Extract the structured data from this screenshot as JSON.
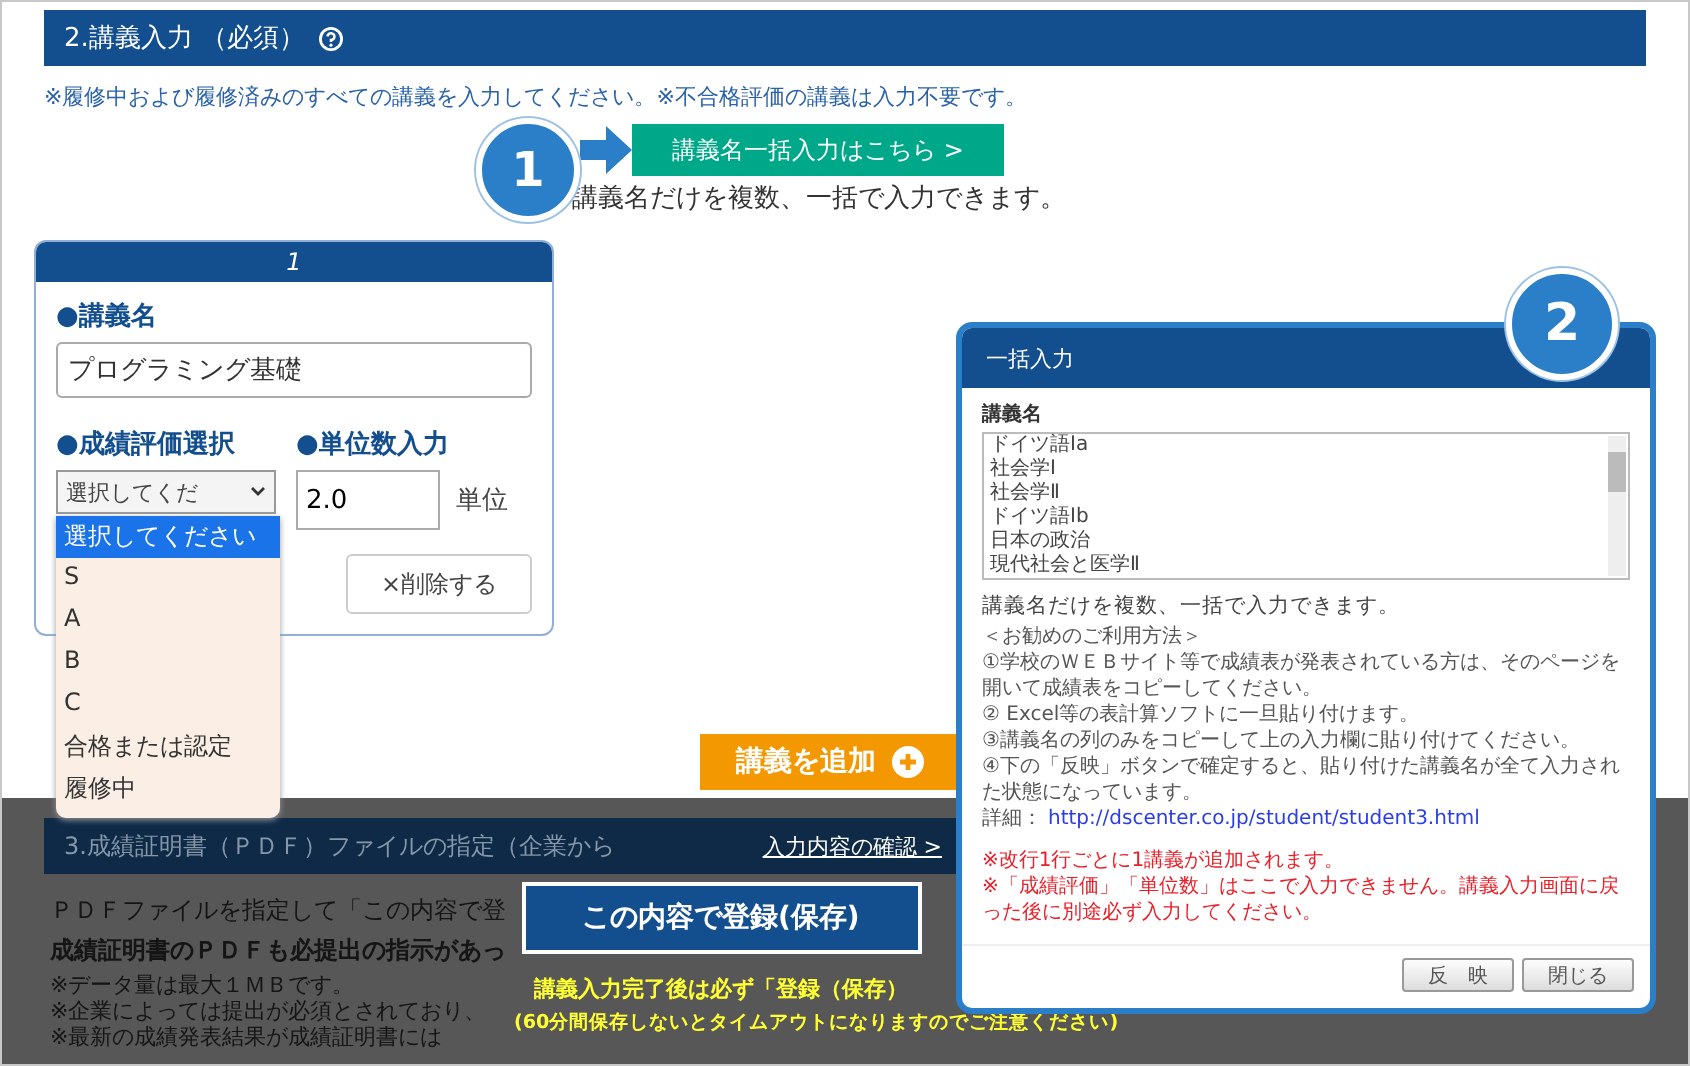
{
  "section2": {
    "title": "2.講義入力 （必須）",
    "note": "※履修中および履修済みのすべての講義を入力してください。※不合格評価の講義は入力不要です。",
    "step_badge": "1",
    "bulk_button": "講義名一括入力はこちら >",
    "bulk_caption": "講義名だけを複数、一括で入力できます。"
  },
  "course_card": {
    "number": "1",
    "name_label": "●講義名",
    "name_value": "プログラミング基礎",
    "grade_label": "●成績評価選択",
    "grade_value": "選択してくだ",
    "credit_label": "●単位数入力",
    "credit_value": "2.0",
    "credit_unit": "単位",
    "delete_button": "×削除する",
    "grade_options": [
      {
        "label": "選択してください",
        "selected": true
      },
      {
        "label": "S",
        "selected": false
      },
      {
        "label": "A",
        "selected": false
      },
      {
        "label": "B",
        "selected": false
      },
      {
        "label": "C",
        "selected": false
      },
      {
        "label": "合格または認定",
        "selected": false
      },
      {
        "label": "履修中",
        "selected": false
      }
    ]
  },
  "add_button": "講義を追加",
  "section3": {
    "title": "3.成績証明書（ＰＤＦ）ファイルの指定（企業から",
    "confirm_link": "入力内容の確認 >",
    "instruction": "ＰＤＦファイルを指定して「この内容で登",
    "bold_note": "成績証明書のＰＤＦも必提出の指示があっ",
    "notes": [
      "※データ量は最大１ＭＢです。",
      "※企業によっては提出が必須とされており、",
      "※最新の成績発表結果が成績証明書には"
    ],
    "register_button": "この内容で登録(保存)",
    "warning": [
      "講義入力完了後は必ず「登録（保存）",
      "(60分間保存しないとタイムアウトになりますのでご注意ください)"
    ]
  },
  "modal": {
    "title": "一括入力",
    "step_badge": "2",
    "field_label": "講義名",
    "lines": [
      "ドイツ語Ⅰa",
      "社会学Ⅰ",
      "社会学Ⅱ",
      "ドイツ語Ⅰb",
      "日本の政治",
      "現代社会と医学Ⅱ"
    ],
    "caption": "講義名だけを複数、一括で入力できます。",
    "howto_title": "＜お勧めのご利用方法＞",
    "steps": [
      "①学校のＷＥＢサイト等で成績表が発表されている方は、そのページを開いて成績表をコピーしてください。",
      "② Excel等の表計算ソフトに一旦貼り付けます。",
      "③講義名の列のみをコピーして上の入力欄に貼り付けてください。",
      "④下の「反映」ボタンで確定すると、貼り付けた講義名が全て入力された状態になっています。"
    ],
    "detail_label": "詳細：",
    "detail_link": "http://dscenter.co.jp/student/student3.html",
    "warnings": [
      "※改行1行ごとに1講義が追加されます。",
      "※「成績評価」「単位数」はここで入力できません。講義入力画面に戻った後に別途必ず入力してください。"
    ],
    "buttons": [
      "反　映",
      "閉じる"
    ]
  }
}
